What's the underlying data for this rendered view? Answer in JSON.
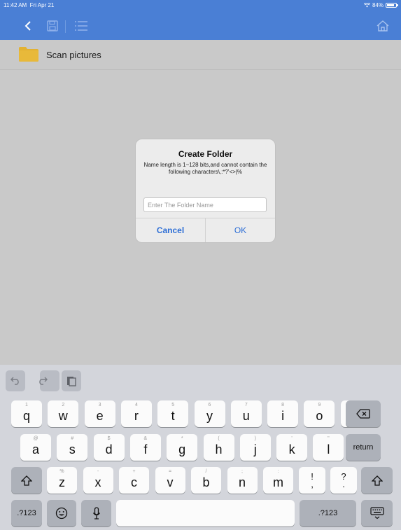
{
  "status": {
    "time": "11:42 AM",
    "date": "Fri Apr 21",
    "battery": "84%",
    "battery_level": 0.84
  },
  "toolbar": {
    "back_icon": "chevron-left-icon",
    "save_icon": "save-icon",
    "list_icon": "list-icon",
    "home_icon": "home-icon",
    "accent": "#4a7fd5"
  },
  "files": [
    {
      "name": "Scan pictures",
      "icon": "folder-icon",
      "color": "#e3b232"
    }
  ],
  "dialog": {
    "title": "Create Folder",
    "message": "Name length is 1~128 bits,and cannot contain the following characters\\,:*?'<>|%",
    "input_placeholder": "Enter The Folder Name",
    "input_value": "",
    "cancel_label": "Cancel",
    "ok_label": "OK"
  },
  "keyboard": {
    "accessory": [
      "undo-icon",
      "redo-icon",
      "paste-icon"
    ],
    "row1": [
      {
        "hint": "1",
        "key": "q"
      },
      {
        "hint": "2",
        "key": "w"
      },
      {
        "hint": "3",
        "key": "e"
      },
      {
        "hint": "4",
        "key": "r"
      },
      {
        "hint": "5",
        "key": "t"
      },
      {
        "hint": "6",
        "key": "y"
      },
      {
        "hint": "7",
        "key": "u"
      },
      {
        "hint": "8",
        "key": "i"
      },
      {
        "hint": "9",
        "key": "o"
      },
      {
        "hint": "0",
        "key": "p"
      }
    ],
    "row2": [
      {
        "hint": "@",
        "key": "a"
      },
      {
        "hint": "#",
        "key": "s"
      },
      {
        "hint": "$",
        "key": "d"
      },
      {
        "hint": "&",
        "key": "f"
      },
      {
        "hint": "*",
        "key": "g"
      },
      {
        "hint": "(",
        "key": "h"
      },
      {
        "hint": ")",
        "key": "j"
      },
      {
        "hint": "'",
        "key": "k"
      },
      {
        "hint": "\"",
        "key": "l"
      }
    ],
    "row3": [
      {
        "hint": "%",
        "key": "z"
      },
      {
        "hint": "-",
        "key": "x"
      },
      {
        "hint": "+",
        "key": "c"
      },
      {
        "hint": "=",
        "key": "v"
      },
      {
        "hint": "/",
        "key": "b"
      },
      {
        "hint": ";",
        "key": "n"
      },
      {
        "hint": ":",
        "key": "m"
      }
    ],
    "row3_punct": [
      {
        "top": "!",
        "bottom": ","
      },
      {
        "top": "?",
        "bottom": "."
      }
    ],
    "return_label": "return",
    "numbers_label": ".?123",
    "backspace_icon": "backspace-icon",
    "shift_icon": "shift-icon",
    "emoji_icon": "emoji-icon",
    "mic_icon": "microphone-icon",
    "hide_icon": "keyboard-hide-icon"
  }
}
